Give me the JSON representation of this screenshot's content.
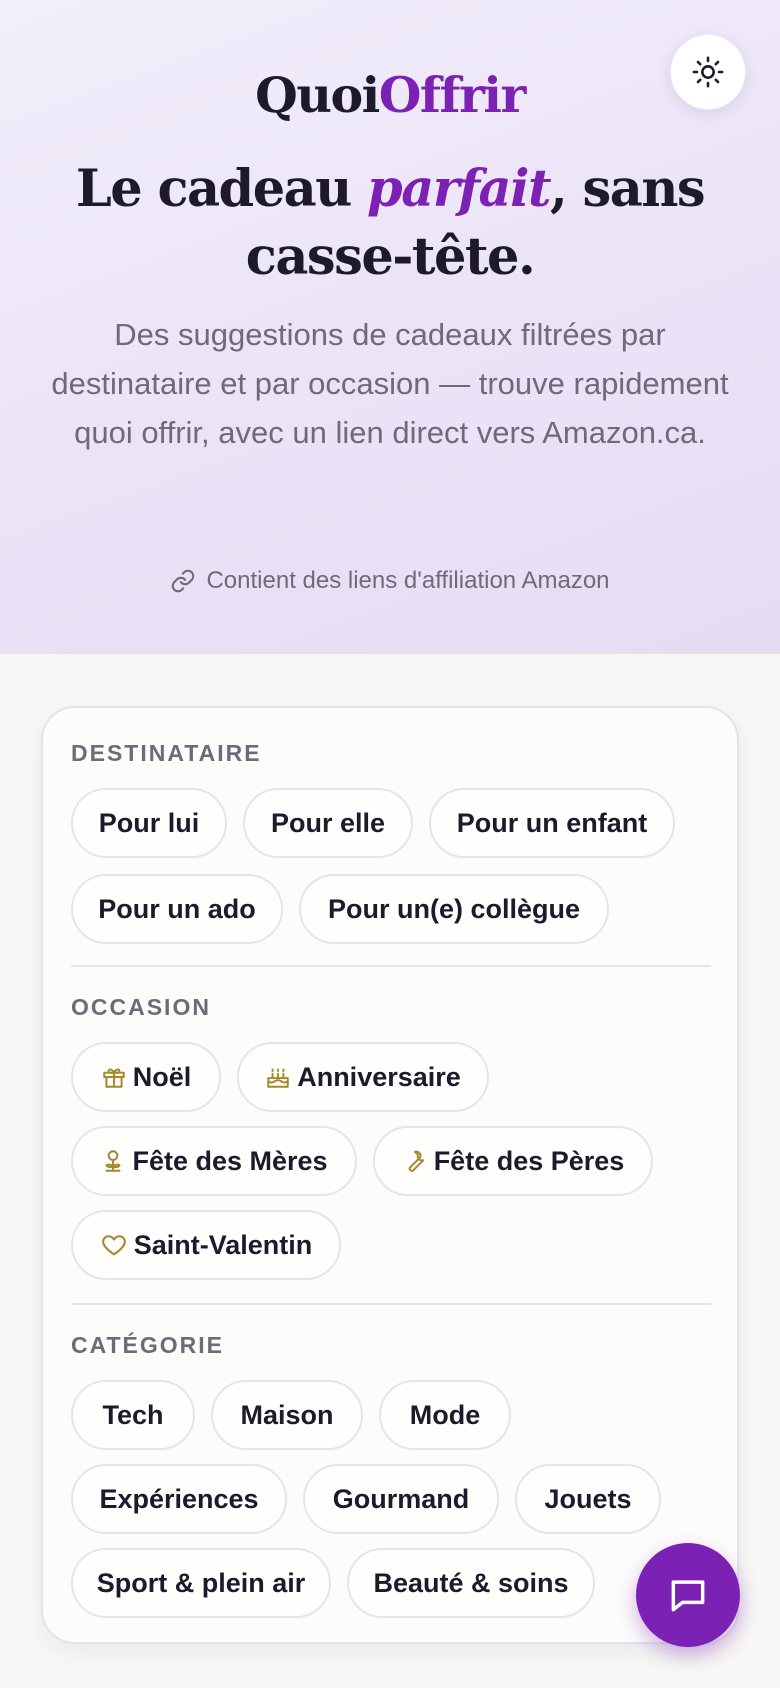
{
  "brand": {
    "part1": "Quoi",
    "part2": "Offrir"
  },
  "hero": {
    "headline_before": "Le cadeau ",
    "headline_emphasis": "parfait",
    "headline_after": ", sans casse-tête.",
    "subtitle": "Des suggestions de cadeaux filtrées par destinataire et par occasion — trouve rapidement quoi offrir, avec un lien direct vers Amazon.ca.",
    "affiliate_note": "Contient des liens d'affiliation Amazon"
  },
  "filters": {
    "recipient": {
      "label": "DESTINATAIRE",
      "options": [
        "Pour lui",
        "Pour elle",
        "Pour un enfant",
        "Pour un ado",
        "Pour un(e) collègue"
      ]
    },
    "occasion": {
      "label": "OCCASION",
      "options": [
        {
          "label": "Noël",
          "icon": "gift-icon"
        },
        {
          "label": "Anniversaire",
          "icon": "cake-icon"
        },
        {
          "label": "Fête des Mères",
          "icon": "flower-icon"
        },
        {
          "label": "Fête des Pères",
          "icon": "wrench-icon"
        },
        {
          "label": "Saint-Valentin",
          "icon": "heart-icon"
        }
      ]
    },
    "category": {
      "label": "CATÉGORIE",
      "options": [
        "Tech",
        "Maison",
        "Mode",
        "Expériences",
        "Gourmand",
        "Jouets",
        "Sport & plein air",
        "Beauté & soins"
      ]
    }
  },
  "colors": {
    "accent": "#7b22b5",
    "icon_gold": "#a8862a",
    "text": "#1d1a2b",
    "muted": "#6e6a78"
  },
  "icons": {
    "theme_toggle": "sun-icon",
    "affiliate": "link-icon",
    "chat": "chat-bubble-icon"
  }
}
